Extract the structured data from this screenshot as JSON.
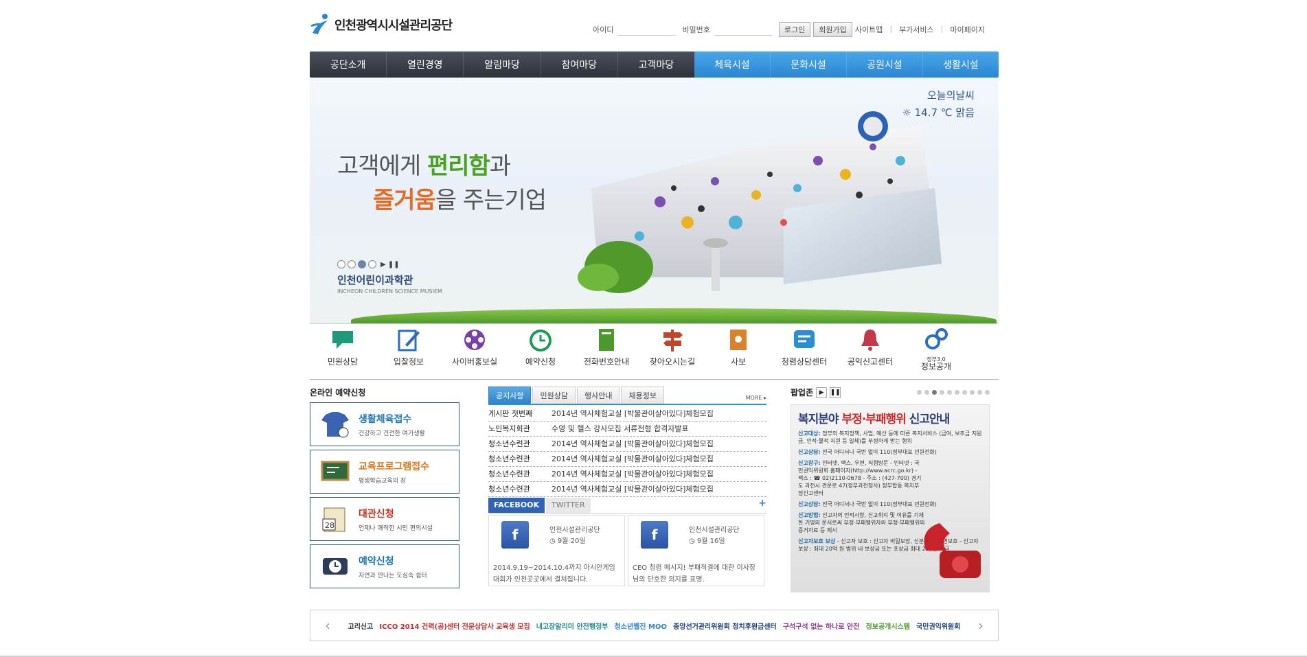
{
  "header": {
    "site_name": "인천광역시시설관리공단",
    "login_id_label": "아이디",
    "login_pw_label": "비밀번호",
    "login_button": "로그인",
    "join_button": "회원가입",
    "util": [
      "사이트맵",
      "부가서비스",
      "마이페이지"
    ]
  },
  "gnb": {
    "left": [
      "공단소개",
      "열린경영",
      "알림마당",
      "참여마당",
      "고객마당"
    ],
    "right": [
      "체육시설",
      "문화시설",
      "공원시설",
      "생활시설"
    ]
  },
  "hero": {
    "weather_title": "오늘의날씨",
    "weather_value": "14.7 ℃  맑음",
    "slogan1_a": "고객에게 ",
    "slogan1_b": "편리함",
    "slogan1_c": "과",
    "slogan2_a": "즐거움",
    "slogan2_b": "을 주는기업",
    "caption_kr": "인천어린이과학관",
    "caption_en": "INCHEON CHILDREN SCIENCE MUSIEM",
    "slide_controls": "▶ ❚❚"
  },
  "quick": [
    {
      "label": "민원상담",
      "icon": "speech-bubble-icon",
      "color": "#1e9a7a"
    },
    {
      "label": "입찰정보",
      "icon": "edit-icon",
      "color": "#2a6fbf"
    },
    {
      "label": "사이버홍보실",
      "icon": "film-reel-icon",
      "color": "#7a3fa6"
    },
    {
      "label": "예약신청",
      "icon": "clock-arrow-icon",
      "color": "#1e9a5a"
    },
    {
      "label": "전화번호안내",
      "icon": "phonebook-icon",
      "color": "#4a9a2a"
    },
    {
      "label": "찾아오시는길",
      "icon": "signpost-icon",
      "color": "#c2452a"
    },
    {
      "label": "사보",
      "icon": "book-icon",
      "color": "#d9822b"
    },
    {
      "label": "청렴상담센터",
      "icon": "chat-icon",
      "color": "#2a8fd0"
    },
    {
      "label": "공익신고센터",
      "icon": "bell-icon",
      "color": "#c23a4a"
    },
    {
      "label": "정보공개",
      "sub": "정부3.0",
      "icon": "gears-icon",
      "color": "#2a6fbf"
    }
  ],
  "online": {
    "title": "온라인 예약신청",
    "items": [
      {
        "title": "생활체육접수",
        "sub": "건강하고 건전한 여가생활",
        "color": "#1f78b8"
      },
      {
        "title": "교육프로그램접수",
        "sub": "평생학습교육의 장",
        "color": "#d97a16"
      },
      {
        "title": "대관신청",
        "sub": "언제나 쾌적한 시민 편의시설",
        "color": "#c8331f"
      },
      {
        "title": "예약신청",
        "sub": "자연과 만나는 도심속 쉼터",
        "color": "#1f78b8"
      }
    ]
  },
  "news": {
    "tabs": [
      "공지사항",
      "민원상담",
      "행사안내",
      "채용정보"
    ],
    "more": "MORE ▸",
    "items": [
      {
        "cat": "게시판 첫번째",
        "text": "2014년 역사체험교실 [박물관이살아있다]체험모집"
      },
      {
        "cat": "노인복지회관",
        "text": "수영 및 헬스 강사모집 서류전형 합격자발표"
      },
      {
        "cat": "청소년수련관",
        "text": "2014년 역사체험교실 [박물관이살아있다]체험모집"
      },
      {
        "cat": "청소년수련관",
        "text": "2014년 역사체험교실 [박물관이살아있다]체험모집"
      },
      {
        "cat": "청소년수련관",
        "text": "2014년 역사체험교실 [박물관이살아있다]체험모집"
      },
      {
        "cat": "청소년수련관",
        "text": "2014년 역사체험교실 [박물관이살아있다]체험모집"
      }
    ]
  },
  "sns": {
    "tab_facebook": "FACEBOOK",
    "tab_twitter": "TWITTER",
    "plus": "+",
    "cards": [
      {
        "name": "인천시설관리공단",
        "date": "◷ 9월 20일",
        "body": "2014.9.19~2014.10.4까지 아시안게임 대회가 인천곳곳에서 결쳐집니다."
      },
      {
        "name": "인천시설관리공단",
        "date": "◷ 9월 16일",
        "body": "CEO 청렴 메시지! 부패척결에 대한 이사장님의 단호한 의지를 표명."
      }
    ]
  },
  "popup": {
    "title": "팝업존",
    "panel_title_a": "복지분야 ",
    "panel_title_b": "부정·부패행위",
    "panel_title_c": " 신고안내",
    "lines": [
      {
        "k": "신고대상:",
        "v": "정부의 복지정책, 사업, 예산 등에 따른 복지서비스 (급여, 보조금 지원금, 인적·물적 지원 등 일체)를 부정하게 받는 행위"
      },
      {
        "k": "신고상담:",
        "v": "전국 어디서나 국번 없이 110(정부대표 민원전화)"
      },
      {
        "k": "신고창구:",
        "v": "인터넷, 팩스, 우편, 직접방문 - 인터넷 : 국민권익위원회 홈페이지(http://www.acrc.go.kr) - 팩스 : ☎ 02)2110-0678 - 주소 : (427-700) 경기도 과천시 관문로 47(정부과천청사) 정부합동 복지부정신고센터"
      },
      {
        "k": "신고상담:",
        "v": "전국 어디서나 국번 없이 110(정부대표 민원전화)"
      },
      {
        "k": "신고방법:",
        "v": "신고자의 인적사항, 신고취지 및 이유를 기재한 기명의 문서로써 부정·부패행위자와 부정·부패행위의 증거자료 등 제시"
      },
      {
        "k": "신고자보호 보상",
        "v": "- 신고자 보호 : 신고자 비밀보장, 신분보장, 신변보호 - 신고자 보상 : 최대 20억 원 범위 내 보상금 또는 포상금 최대 2억 원 지급"
      }
    ]
  },
  "banner": {
    "prev": "‹",
    "next": "›",
    "items": [
      "고리신고",
      "ICCO 2014 건력(공)센터 전문상담사 교육생 모집",
      "내고장알리미 안전행정부",
      "청소년웹진 MOO",
      "중앙선거관리위원회 정치후원금센터",
      "구석구석 없는 하나로 안전",
      "정보공개시스템",
      "국민권익위원회"
    ]
  }
}
